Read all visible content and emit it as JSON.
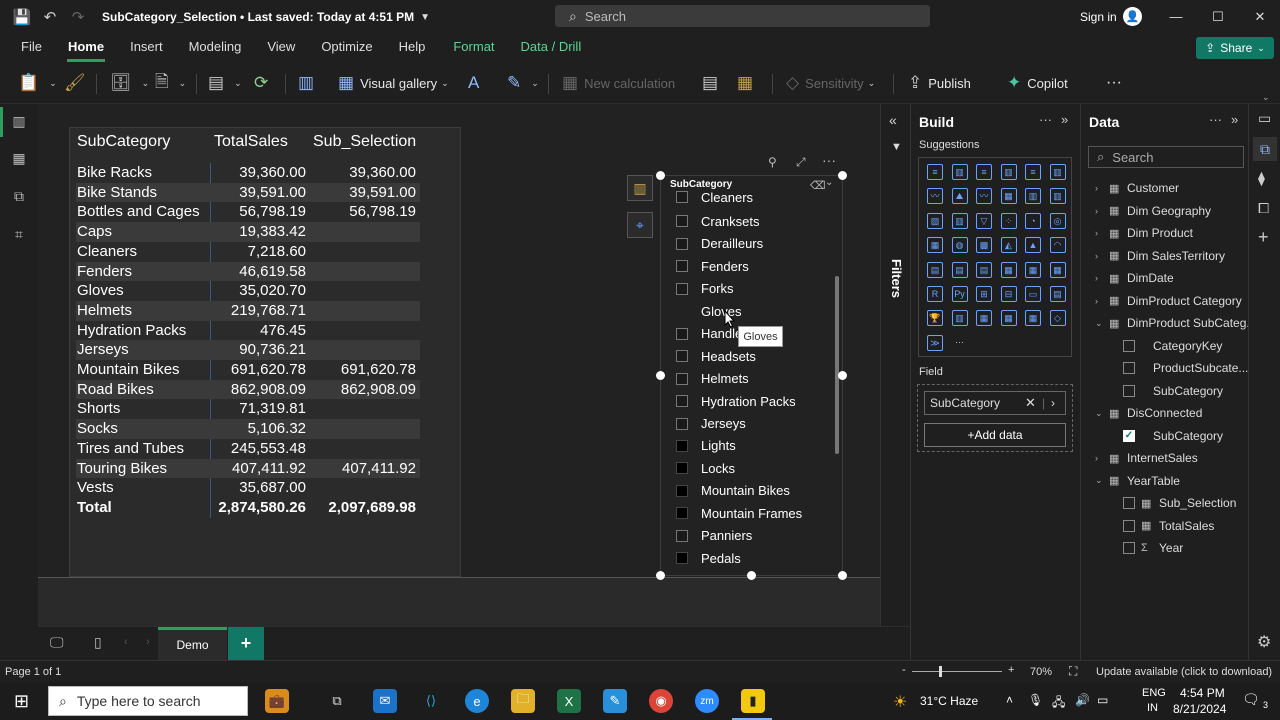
{
  "title": {
    "doc": "SubCategory_Selection",
    "saved": "Last saved: Today at 4:51 PM"
  },
  "search": {
    "placeholder": "Search"
  },
  "account": {
    "signin": "Sign in"
  },
  "menu": [
    "File",
    "Home",
    "Insert",
    "Modeling",
    "View",
    "Optimize",
    "Help",
    "Format",
    "Data / Drill"
  ],
  "share": "Share",
  "ribbon": {
    "visual_gallery": "Visual gallery",
    "new_calculation": "New calculation",
    "sensitivity": "Sensitivity",
    "publish": "Publish",
    "copilot": "Copilot"
  },
  "table": {
    "headers": [
      "SubCategory",
      "TotalSales",
      "Sub_Selection"
    ],
    "rows": [
      [
        "Bike Racks",
        "39,360.00",
        "39,360.00"
      ],
      [
        "Bike Stands",
        "39,591.00",
        "39,591.00"
      ],
      [
        "Bottles and Cages",
        "56,798.19",
        "56,798.19"
      ],
      [
        "Caps",
        "19,383.42",
        ""
      ],
      [
        "Cleaners",
        "7,218.60",
        ""
      ],
      [
        "Fenders",
        "46,619.58",
        ""
      ],
      [
        "Gloves",
        "35,020.70",
        ""
      ],
      [
        "Helmets",
        "219,768.71",
        ""
      ],
      [
        "Hydration Packs",
        "476.45",
        ""
      ],
      [
        "Jerseys",
        "90,736.21",
        ""
      ],
      [
        "Mountain Bikes",
        "691,620.78",
        "691,620.78"
      ],
      [
        "Road Bikes",
        "862,908.09",
        "862,908.09"
      ],
      [
        "Shorts",
        "71,319.81",
        ""
      ],
      [
        "Socks",
        "5,106.32",
        ""
      ],
      [
        "Tires and Tubes",
        "245,553.48",
        ""
      ],
      [
        "Touring Bikes",
        "407,411.92",
        "407,411.92"
      ],
      [
        "Vests",
        "35,687.00",
        ""
      ]
    ],
    "total": [
      "Total",
      "2,874,580.26",
      "2,097,689.98"
    ]
  },
  "slicer": {
    "header": "SubCategory",
    "items": [
      {
        "label": "Cleaners",
        "state": "empty"
      },
      {
        "label": "Cranksets",
        "state": "empty"
      },
      {
        "label": "Derailleurs",
        "state": "empty"
      },
      {
        "label": "Fenders",
        "state": "empty"
      },
      {
        "label": "Forks",
        "state": "empty"
      },
      {
        "label": "Gloves",
        "state": "hover"
      },
      {
        "label": "Handlebars",
        "state": "empty"
      },
      {
        "label": "Headsets",
        "state": "empty"
      },
      {
        "label": "Helmets",
        "state": "empty"
      },
      {
        "label": "Hydration Packs",
        "state": "empty"
      },
      {
        "label": "Jerseys",
        "state": "empty"
      },
      {
        "label": "Lights",
        "state": "filled"
      },
      {
        "label": "Locks",
        "state": "filled"
      },
      {
        "label": "Mountain Bikes",
        "state": "filled"
      },
      {
        "label": "Mountain Frames",
        "state": "filled"
      },
      {
        "label": "Panniers",
        "state": "empty"
      },
      {
        "label": "Pedals",
        "state": "filled"
      }
    ],
    "tooltip": "Gloves"
  },
  "filters": {
    "label": "Filters"
  },
  "build": {
    "title": "Build",
    "suggestions": "Suggestions",
    "field_label": "Field",
    "field_value": "SubCategory",
    "add_data": "+Add data"
  },
  "data_pane": {
    "title": "Data",
    "search_placeholder": "Search",
    "tree": [
      {
        "label": "Customer",
        "level": 0,
        "expand": "›"
      },
      {
        "label": "Dim Geography",
        "level": 0,
        "expand": "›"
      },
      {
        "label": "Dim Product",
        "level": 0,
        "expand": "›"
      },
      {
        "label": "Dim SalesTerritory",
        "level": 0,
        "expand": "›"
      },
      {
        "label": "DimDate",
        "level": 0,
        "expand": "›"
      },
      {
        "label": "DimProduct Category",
        "level": 0,
        "expand": "›"
      },
      {
        "label": "DimProduct SubCateg...",
        "level": 0,
        "expand": "⌄"
      },
      {
        "label": "CategoryKey",
        "level": 1
      },
      {
        "label": "ProductSubcate...",
        "level": 1
      },
      {
        "label": "SubCategory",
        "level": 1
      },
      {
        "label": "DisConnected",
        "level": 0,
        "expand": "⌄"
      },
      {
        "label": "SubCategory",
        "level": 1,
        "checked": true
      },
      {
        "label": "InternetSales",
        "level": 0,
        "expand": "›"
      },
      {
        "label": "YearTable",
        "level": 0,
        "expand": "⌄"
      },
      {
        "label": "Sub_Selection",
        "level": 1,
        "icon": "calc"
      },
      {
        "label": "TotalSales",
        "level": 1,
        "icon": "calc"
      },
      {
        "label": "Year",
        "level": 1,
        "icon": "sum"
      }
    ]
  },
  "pages": {
    "active": "Demo",
    "add": "+"
  },
  "status": {
    "page": "Page 1 of 1",
    "zoom": "70%",
    "update": "Update available (click to download)"
  },
  "taskbar": {
    "search_placeholder": "Type here to search",
    "weather": "31°C  Haze",
    "lang1": "ENG",
    "lang2": "IN",
    "time": "4:54 PM",
    "date": "8/21/2024",
    "notif": "3"
  }
}
